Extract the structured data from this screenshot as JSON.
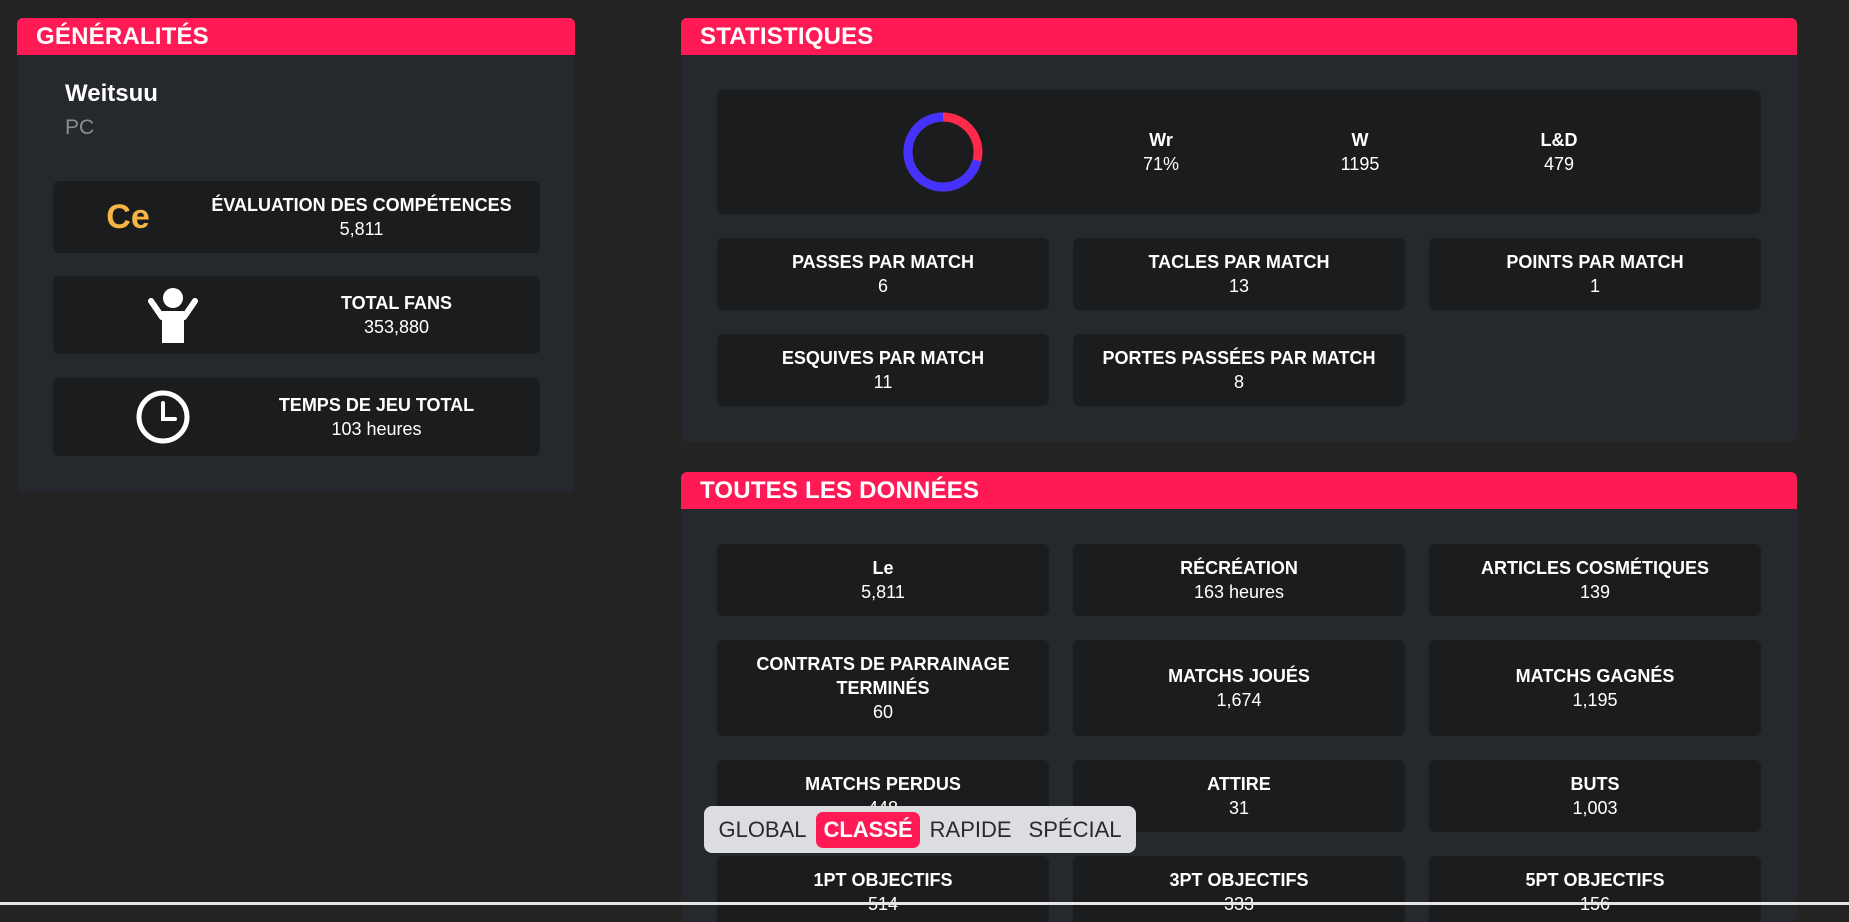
{
  "general": {
    "title": "GÉNÉRALITÉS",
    "player_name": "Weitsuu",
    "platform": "PC",
    "cards": [
      {
        "badge": "Ce",
        "label": "ÉVALUATION DES COMPÉTENCES",
        "value": "5,811",
        "icon": "rank-badge"
      },
      {
        "label": "TOTAL FANS",
        "value": "353,880",
        "icon": "person-cheer-icon"
      },
      {
        "label": "TEMPS DE JEU TOTAL",
        "value": "103 heures",
        "icon": "clock-icon"
      }
    ]
  },
  "stats": {
    "title": "STATISTIQUES",
    "summary": {
      "wr_label": "Wr",
      "wr_value": "71%",
      "w_label": "W",
      "w_value": "1195",
      "ld_label": "L&D",
      "ld_value": "479"
    },
    "donut": {
      "win_fraction": 0.71,
      "win_color": "#4433ff",
      "loss_color": "#ff2a4a"
    },
    "tiles": [
      {
        "label": "PASSES PAR MATCH",
        "value": "6"
      },
      {
        "label": "TACLES PAR MATCH",
        "value": "13"
      },
      {
        "label": "POINTS PAR MATCH",
        "value": "1"
      },
      {
        "label": "ESQUIVES PAR MATCH",
        "value": "11"
      },
      {
        "label": "PORTES PASSÉES PAR MATCH",
        "value": "8"
      }
    ]
  },
  "all_data": {
    "title": "TOUTES LES DONNÉES",
    "tiles": [
      {
        "label": "Le",
        "value": "5,811"
      },
      {
        "label": "RÉCRÉATION",
        "value": "163 heures"
      },
      {
        "label": "ARTICLES COSMÉTIQUES",
        "value": "139"
      },
      {
        "label": "CONTRATS DE PARRAINAGE TERMINÉS",
        "value": "60"
      },
      {
        "label": "MATCHS JOUÉS",
        "value": "1,674"
      },
      {
        "label": "MATCHS GAGNÉS",
        "value": "1,195"
      },
      {
        "label": "MATCHS PERDUS",
        "value": "448"
      },
      {
        "label": "ATTIRE",
        "value": "31"
      },
      {
        "label": "BUTS",
        "value": "1,003"
      },
      {
        "label": "1PT OBJECTIFS",
        "value": "514"
      },
      {
        "label": "3PT OBJECTIFS",
        "value": "333"
      },
      {
        "label": "5PT OBJECTIFS",
        "value": "156"
      }
    ]
  },
  "modes": {
    "items": [
      "GLOBAL",
      "CLASSÉ",
      "RAPIDE",
      "SPÉCIAL"
    ],
    "active": "CLASSÉ"
  },
  "colors": {
    "accent": "#ff1a55",
    "panel_bg": "#25282c",
    "card_bg": "#1b1c1e",
    "rank_badge": "#f6b544"
  }
}
